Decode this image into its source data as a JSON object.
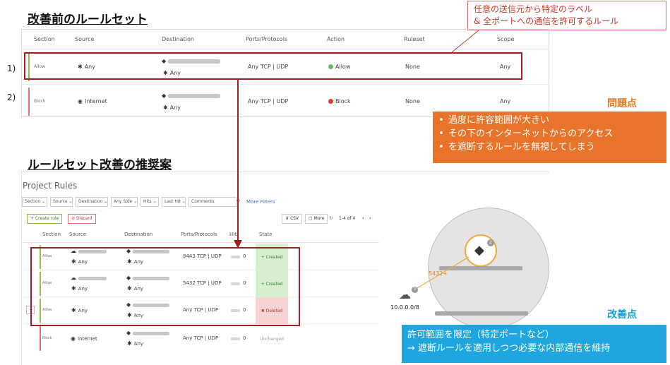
{
  "headings": {
    "before": "改善前のルールセット",
    "after": "ルールセット改善の推奨案"
  },
  "callout_top": {
    "line1": "任意の送信元から特定のラベル",
    "line2": "& 全ポートへの通信を許可するルール"
  },
  "problem": {
    "label": "問題点",
    "bullets": [
      "過度に許容範囲が大きい",
      "その下のインターネットからのアクセス",
      "を遮断するルールを無視してしまう"
    ]
  },
  "improvement": {
    "label": "改善点",
    "line1": "許可範囲を限定（特定ポートなど）",
    "line2": "→ 遮断ルールを適用しつつ必要な内部通信を維持"
  },
  "before_table": {
    "columns": [
      "Section",
      "Source",
      "Destination",
      "Ports/Protocols",
      "Action",
      "Ruleset",
      "Scope"
    ],
    "rows": [
      {
        "num": "1)",
        "section": "Allow",
        "source": "Any",
        "dest_sub": "Any",
        "ports": "Any TCP | UDP",
        "action": "Allow",
        "ruleset": "None",
        "scope": "Any"
      },
      {
        "num": "2)",
        "section": "Block",
        "source": "Internet",
        "dest_sub": "Any",
        "ports": "Any TCP | UDP",
        "action": "Block",
        "ruleset": "None",
        "scope": "Any"
      }
    ]
  },
  "after_panel": {
    "title": "Project Rules",
    "filters": [
      "Section",
      "Source",
      "Destination",
      "Any Side",
      "Hits",
      "Last Hit",
      "Comments"
    ],
    "more_filters": "More Filters",
    "create_rule": "+ Create rule",
    "discard": "Discard",
    "csv": "CSV",
    "more": "More",
    "pagination": "1-4 of 4",
    "columns": [
      "Section",
      "Source",
      "Destination",
      "Ports/Protocols",
      "Hits",
      "State"
    ],
    "rows": [
      {
        "section": "Allow",
        "source_sub": "Any",
        "dest_sub": "Any",
        "ports": "8443 TCP | UDP",
        "hits": "0",
        "state": "Created"
      },
      {
        "section": "Allow",
        "source_sub": "Any",
        "dest_sub": "Any",
        "ports": "5432 TCP | UDP",
        "hits": "0",
        "state": "Created"
      },
      {
        "section": "Allow",
        "source": "Any",
        "dest_sub": "Any",
        "ports": "Any TCP | UDP",
        "hits": "0",
        "state": "Deleted"
      },
      {
        "section": "Block",
        "source": "Internet",
        "dest_sub": "Any",
        "ports": "Any TCP | UDP",
        "hits": "0",
        "state": "Unchanged"
      }
    ]
  },
  "graph": {
    "port_label": "5432+",
    "cidr": "10.0.0.0/8",
    "badge_count": "2",
    "cloud_badge": "3"
  },
  "colors": {
    "allow_bar": "#8bc34a",
    "block_bar": "#e57373",
    "highlight": "#a02020",
    "orange": "#e8732a",
    "blue": "#1fa6df"
  }
}
